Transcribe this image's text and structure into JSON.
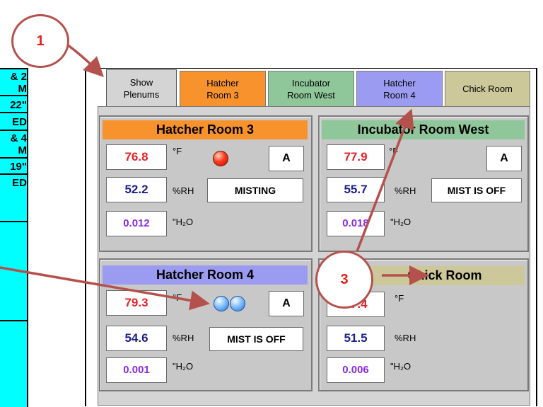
{
  "left_panel": {
    "lines": [
      "& 2",
      "M",
      "22\"",
      "ED",
      "& 4",
      "M",
      "19\"",
      "ED"
    ]
  },
  "tabs": [
    {
      "line1": "Show",
      "line2": "Plenums",
      "color": "#d4d4d4"
    },
    {
      "line1": "Hatcher",
      "line2": "Room 3",
      "color": "#f7922d"
    },
    {
      "line1": "Incubator",
      "line2": "Room West",
      "color": "#8fc79a"
    },
    {
      "line1": "Hatcher",
      "line2": "Room 4",
      "color": "#9b9bf2"
    },
    {
      "line1": "Chick Room",
      "line2": "",
      "color": "#cdc89a"
    }
  ],
  "rooms": {
    "hatcher3": {
      "title": "Hatcher Room 3",
      "temp": "76.8",
      "temp_unit": "°F",
      "rh": "52.2",
      "rh_unit": "%RH",
      "pressure": "0.012",
      "pressure_unit": "\"H₂O",
      "mode": "A",
      "state": "MISTING",
      "color": "#f7922d"
    },
    "incwest": {
      "title": "Incubator Room West",
      "temp": "77.9",
      "temp_unit": "°F",
      "rh": "55.7",
      "rh_unit": "%RH",
      "pressure": "0.018",
      "pressure_unit": "\"H₂O",
      "mode": "A",
      "state": "MIST IS OFF",
      "color": "#8fc79a"
    },
    "hatcher4": {
      "title": "Hatcher Room 4",
      "temp": "79.3",
      "temp_unit": "°F",
      "rh": "54.6",
      "rh_unit": "%RH",
      "pressure": "0.001",
      "pressure_unit": "\"H₂O",
      "mode": "A",
      "state": "MIST IS OFF",
      "color": "#9b9bf2"
    },
    "chick": {
      "title": "Chick Room",
      "temp": "77.4",
      "temp_unit": "°F",
      "rh": "51.5",
      "rh_unit": "%RH",
      "pressure": "0.006",
      "pressure_unit": "\"H₂O",
      "color": "#cdc89a"
    }
  },
  "callouts": [
    "1",
    "3"
  ],
  "colors": {
    "callout_ring": "#b5514d",
    "callout_text": "#e3201b",
    "arrow": "#b5514d"
  }
}
